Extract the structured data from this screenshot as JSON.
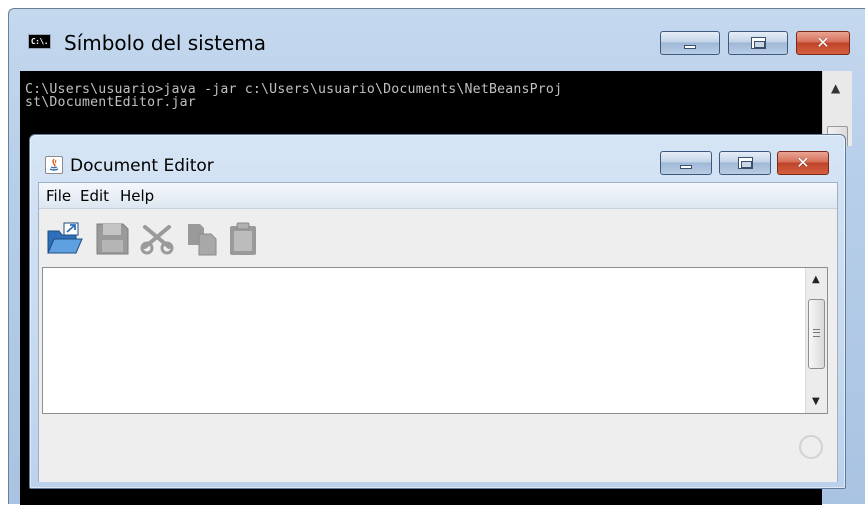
{
  "cmd_window": {
    "title": "Símbolo del sistema",
    "icon": {
      "name": "command-prompt-icon",
      "text": "C:\\."
    },
    "console_lines": [
      "C:\\Users\\usuario>java -jar c:\\Users\\usuario\\Documents\\NetBeansProj",
      "st\\DocumentEditor.jar"
    ],
    "scroll_up_glyph": "▲",
    "caption_buttons": {
      "minimize": "minimize",
      "maximize": "maximize",
      "close": "✕"
    }
  },
  "editor_window": {
    "title": "Document Editor",
    "icon": "java-icon",
    "menu": [
      "File",
      "Edit",
      "Help"
    ],
    "toolbar": [
      {
        "name": "open-icon",
        "enabled": true
      },
      {
        "name": "save-icon",
        "enabled": false
      },
      {
        "name": "cut-icon",
        "enabled": false
      },
      {
        "name": "copy-icon",
        "enabled": false
      },
      {
        "name": "paste-icon",
        "enabled": false
      }
    ],
    "text_content": "",
    "scroll": {
      "up_glyph": "▲",
      "down_glyph": "▼"
    },
    "caption_buttons": {
      "minimize": "minimize",
      "maximize": "maximize",
      "close": "✕"
    }
  },
  "colors": {
    "console_bg": "#000000",
    "console_text": "#c0c0c0",
    "close_button": "#c0442a",
    "title_bar": "#c4d8ee",
    "open_icon_blue": "#2d6fb8",
    "disabled_icon": "#9a9a9a"
  }
}
